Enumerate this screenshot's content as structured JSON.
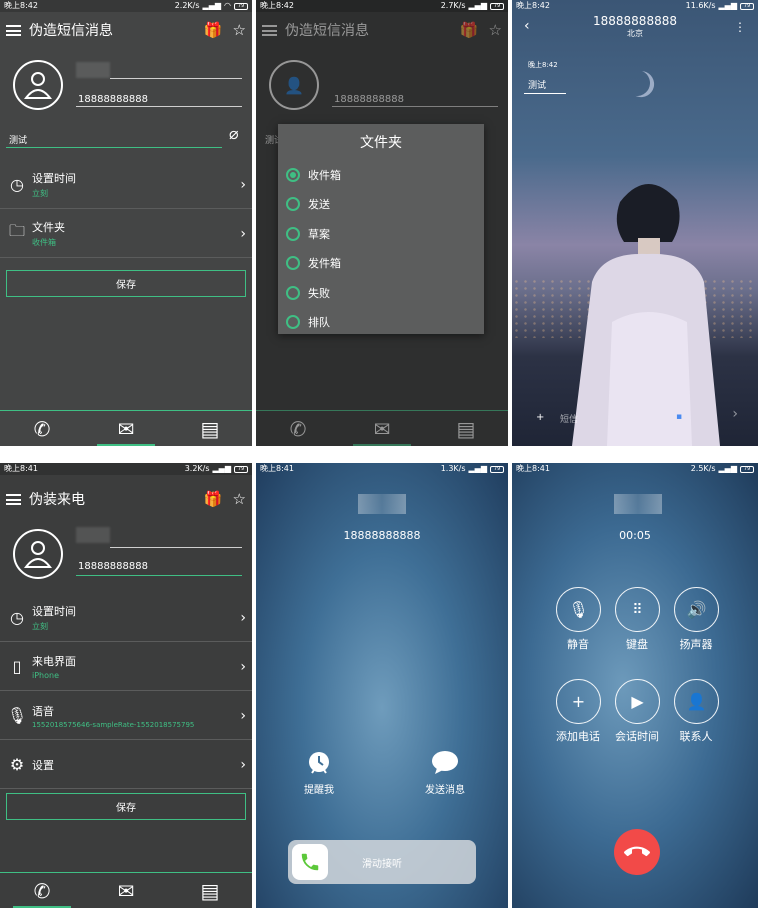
{
  "screen1": {
    "status": {
      "time": "晚上8:42",
      "speed": "2.2K/s",
      "battery": "79"
    },
    "title": "伪造短信消息",
    "phone": "18888888888",
    "message": "测试",
    "rows": [
      {
        "label": "设置时间",
        "sub": "立刻"
      },
      {
        "label": "文件夹",
        "sub": "收件箱"
      }
    ],
    "save": "保存"
  },
  "screen2": {
    "status": {
      "time": "晚上8:42",
      "speed": "2.7K/s",
      "battery": "79"
    },
    "title": "伪造短信消息",
    "phone": "18888888888",
    "message": "测试",
    "dialog_title": "文件夹",
    "options": [
      "收件箱",
      "发送",
      "草案",
      "发件箱",
      "失败",
      "排队"
    ]
  },
  "screen3": {
    "status": {
      "time": "晚上8:42",
      "speed": "11.6K/s",
      "battery": "79"
    },
    "number": "18888888888",
    "city": "北京",
    "msg_time": "晚上8:42",
    "message": "测试",
    "input_placeholder": "短信"
  },
  "screen4": {
    "status": {
      "time": "晚上8:41",
      "speed": "3.2K/s",
      "battery": "79"
    },
    "title": "伪装来电",
    "phone": "18888888888",
    "rows": [
      {
        "label": "设置时间",
        "sub": "立刻"
      },
      {
        "label": "来电界面",
        "sub": "iPhone"
      },
      {
        "label": "语音",
        "sub": "1552018575646-sampleRate-1552018575795"
      },
      {
        "label": "设置",
        "sub": ""
      }
    ],
    "save": "保存"
  },
  "screen5": {
    "status": {
      "time": "晚上8:41",
      "speed": "1.3K/s",
      "battery": "79"
    },
    "number": "18888888888",
    "remind": "提醒我",
    "message": "发送消息",
    "slide": "滑动接听"
  },
  "screen6": {
    "status": {
      "time": "晚上8:41",
      "speed": "2.5K/s",
      "battery": "79"
    },
    "duration": "00:05",
    "buttons": [
      "静音",
      "键盘",
      "扬声器",
      "添加电话",
      "会话时间",
      "联系人"
    ]
  },
  "colors": {
    "accent": "#3fbf84",
    "hangup": "#f24a48"
  }
}
